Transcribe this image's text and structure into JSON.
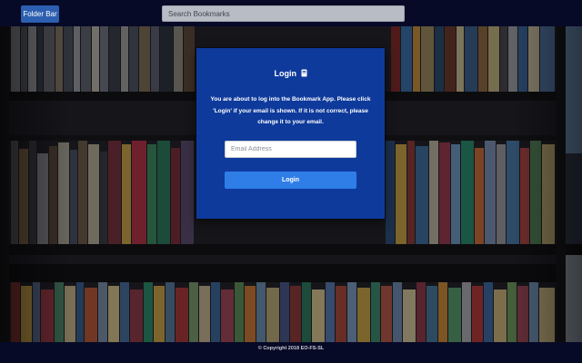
{
  "header": {
    "folder_bar_label": "Folder Bar",
    "search_placeholder": "Search Bookmarks"
  },
  "login": {
    "title": "Login",
    "title_icon": "book-icon",
    "message": "You are about to log into the Bookmark App. Please click 'Login' if your email is shown. If it is not correct, please change it to your email.",
    "email_placeholder": "Email Address",
    "email_value": "",
    "button_label": "Login"
  },
  "footer": {
    "copyright": "© Copyright 2018 EO-FS-SL"
  },
  "colors": {
    "topbar_bg": "#060a26",
    "card_bg": "#0e3a9c",
    "button_blue": "#2f7ee8",
    "folder_button": "#2d5fb0"
  }
}
